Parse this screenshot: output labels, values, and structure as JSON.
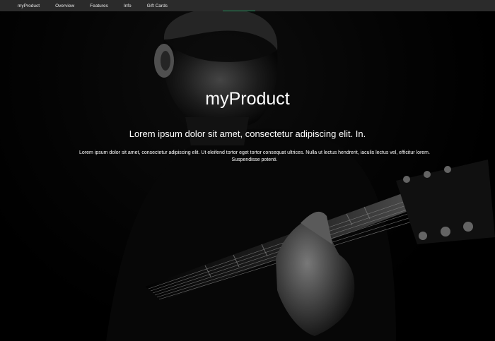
{
  "nav": {
    "brand": "myProduct",
    "items": [
      "Overview",
      "Features",
      "Info",
      "Gift Cards"
    ]
  },
  "hero": {
    "title": "myProduct",
    "subtitle": "Lorem ipsum dolor sit amet, consectetur adipiscing elit. In.",
    "body": "Lorem ipsum dolor sit amet, consectetur adipiscing elit. Ut eleifend tortor eget tortor consequat ultrices. Nulla ut lectus hendrerit, iaculis lectus vel, efficitur lorem. Suspendisse potenti."
  },
  "colors": {
    "navbar": "#2b2b2b",
    "accent": "#1f8f5a",
    "background": "#000000",
    "text": "#ffffff"
  }
}
